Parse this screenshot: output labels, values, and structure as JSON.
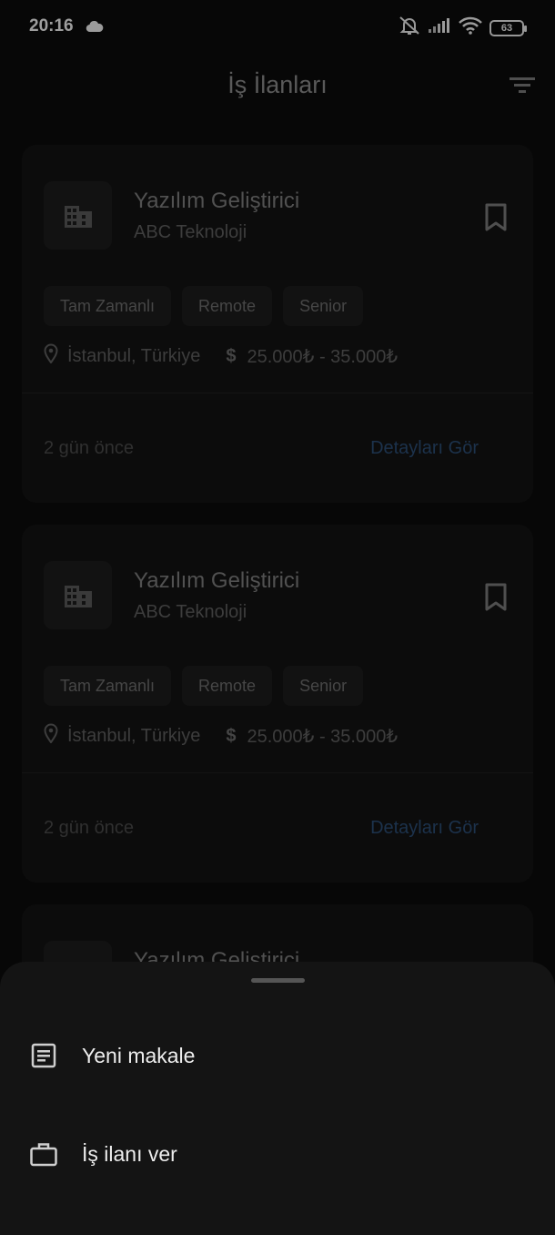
{
  "status_bar": {
    "time": "20:16",
    "battery": "63",
    "icons": [
      "cloud-icon",
      "mute-icon",
      "signal-icon",
      "wifi-icon",
      "battery-icon"
    ]
  },
  "app_bar": {
    "title": "İş İlanları",
    "filter_icon": "filter-icon"
  },
  "jobs": [
    {
      "title": "Yazılım Geliştirici",
      "company": "ABC Teknoloji",
      "tags": [
        "Tam Zamanlı",
        "Remote",
        "Senior"
      ],
      "location": "İstanbul, Türkiye",
      "salary": "25.000₺ - 35.000₺",
      "posted": "2 gün önce",
      "details_label": "Detayları Gör"
    },
    {
      "title": "Yazılım Geliştirici",
      "company": "ABC Teknoloji",
      "tags": [
        "Tam Zamanlı",
        "Remote",
        "Senior"
      ],
      "location": "İstanbul, Türkiye",
      "salary": "25.000₺ - 35.000₺",
      "posted": "2 gün önce",
      "details_label": "Detayları Gör"
    },
    {
      "title": "Yazılım Geliştirici"
    }
  ],
  "bottom_sheet": {
    "items": [
      {
        "label": "Yeni makale",
        "icon": "article-icon"
      },
      {
        "label": "İş ilanı ver",
        "icon": "briefcase-icon"
      }
    ]
  },
  "colors": {
    "background": "#0b0b0b",
    "card": "#131313",
    "link": "#2b4d75",
    "sheet": "#141414"
  }
}
